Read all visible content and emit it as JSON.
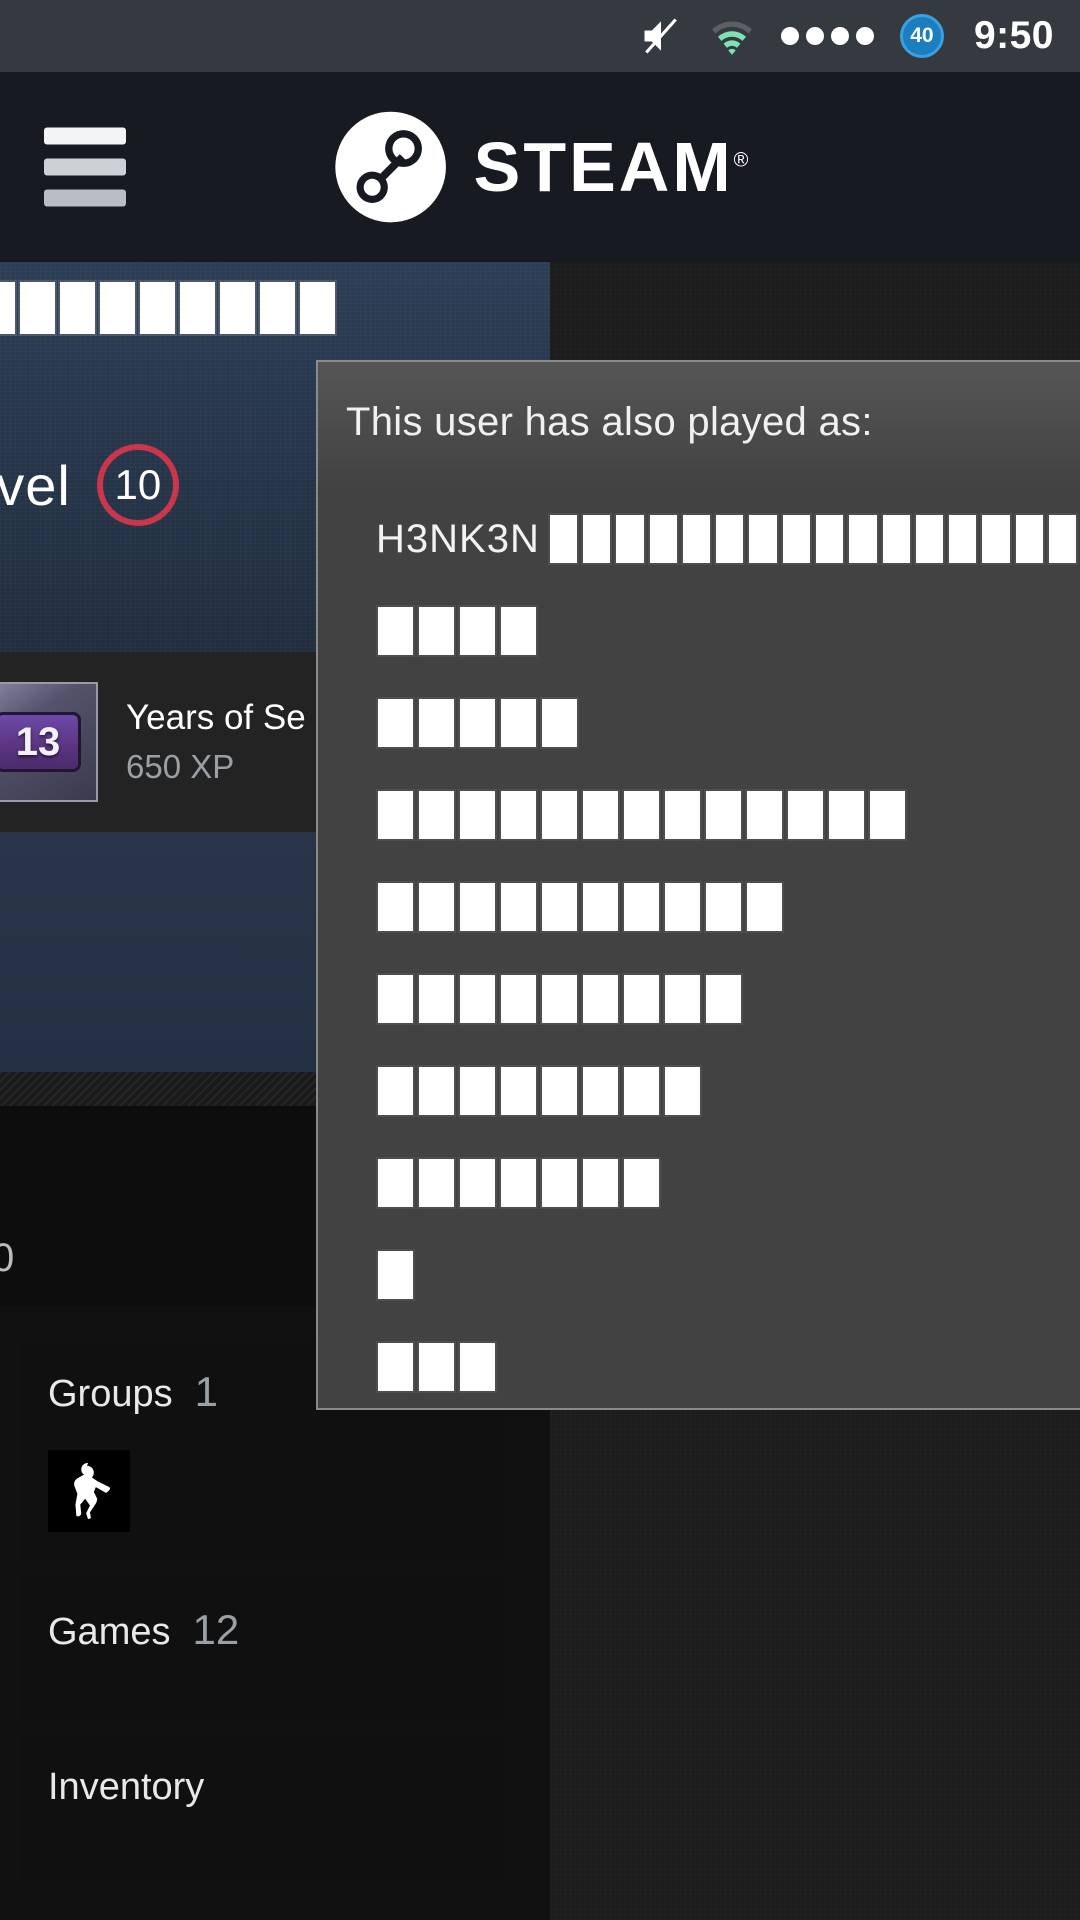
{
  "status_bar": {
    "icons": [
      {
        "name": "mute-icon",
        "label": "volume muted"
      },
      {
        "name": "wifi-icon",
        "label": "wifi connected"
      },
      {
        "name": "signal-dots-icon",
        "label": "signal dots"
      }
    ],
    "dot_count": 4,
    "battery_level": "40",
    "time": "9:50",
    "bg_color": "#343a3f",
    "wifi_color": "#7fe0b6"
  },
  "header": {
    "menu_label": "Menu",
    "brand": "STEAM",
    "registered_mark": "®",
    "bg_color": "#171a21"
  },
  "profile": {
    "persona_name_glyph_count": 9,
    "level_label": "Level",
    "level_value": "10",
    "level_ring_color": "#c8354b",
    "badge": {
      "icon_number": "13",
      "title": "Years of Se",
      "xp": "650 XP"
    },
    "cut_number": "0"
  },
  "sidebar": {
    "cards": [
      {
        "label": "Groups",
        "count": "1",
        "avatar_icon": "counter-strike-soldier-icon"
      },
      {
        "label": "Games",
        "count": "12"
      },
      {
        "label": "Inventory",
        "count": ""
      }
    ]
  },
  "alias_dialog": {
    "title": "This user has also played as:",
    "bg_color": "#424242",
    "border_color": "#8a8a8a",
    "aliases": [
      {
        "name": "H3NK3N",
        "glyph_count": 16
      },
      {
        "name": "",
        "glyph_count": 4
      },
      {
        "name": "",
        "glyph_count": 5
      },
      {
        "name": "",
        "glyph_count": 13
      },
      {
        "name": "",
        "glyph_count": 10
      },
      {
        "name": "",
        "glyph_count": 9
      },
      {
        "name": "",
        "glyph_count": 8
      },
      {
        "name": "",
        "glyph_count": 7
      },
      {
        "name": "",
        "glyph_count": 1
      },
      {
        "name": "",
        "glyph_count": 3
      }
    ]
  }
}
